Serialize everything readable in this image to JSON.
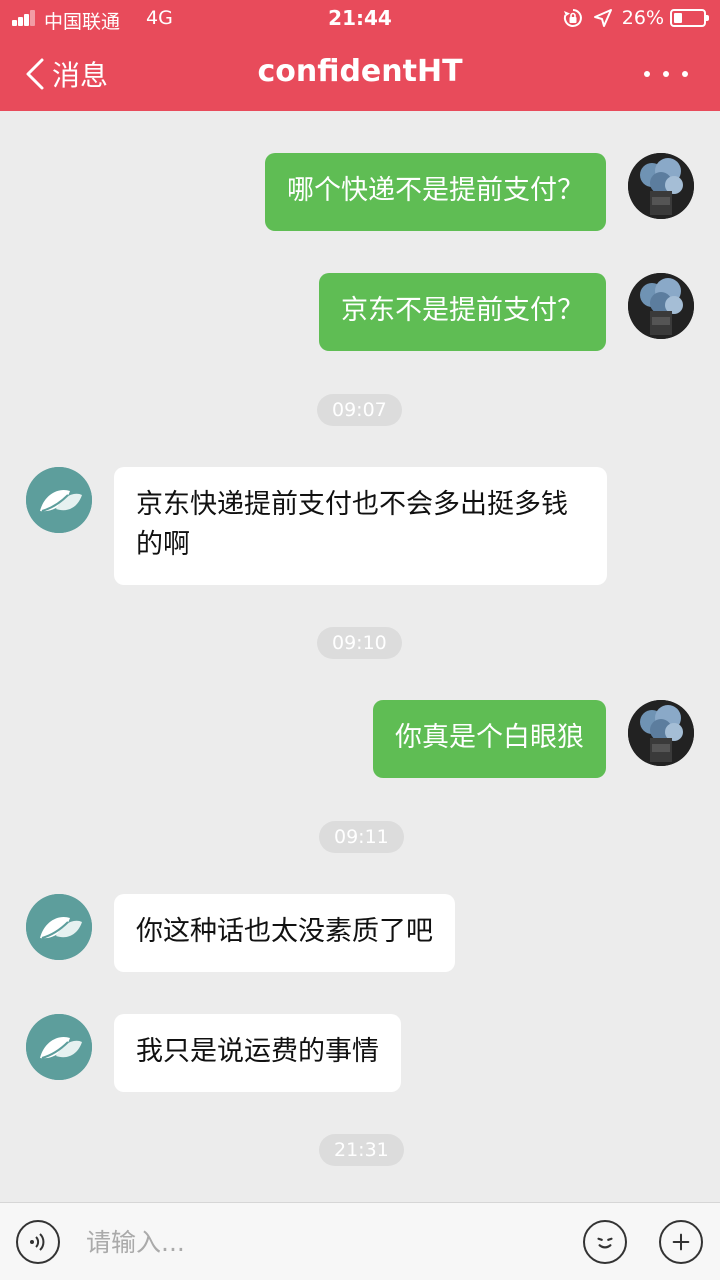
{
  "status_bar": {
    "carrier": "中国联通",
    "network": "4G",
    "time": "21:44",
    "battery": "26%",
    "battery_level": 0.26
  },
  "nav": {
    "back_label": "消息",
    "title": "confidentHT",
    "more_icon": "more-icon"
  },
  "messages": [
    {
      "type": "message",
      "side": "me",
      "text": "哪个快递不是提前支付？"
    },
    {
      "type": "message",
      "side": "me",
      "text": "京东不是提前支付？"
    },
    {
      "type": "timestamp",
      "text": "09:07"
    },
    {
      "type": "message",
      "side": "other",
      "text": "京东快递提前支付也不会多出挺多钱的啊"
    },
    {
      "type": "timestamp",
      "text": "09:10"
    },
    {
      "type": "message",
      "side": "me",
      "text": "你真是个白眼狼"
    },
    {
      "type": "timestamp",
      "text": "09:11"
    },
    {
      "type": "message",
      "side": "other",
      "text": "你这种话也太没素质了吧"
    },
    {
      "type": "message",
      "side": "other",
      "text": "我只是说运费的事情"
    },
    {
      "type": "timestamp",
      "text": "21:31"
    }
  ],
  "input_bar": {
    "placeholder": "请输入...",
    "value": ""
  },
  "colors": {
    "header": "#e84b5b",
    "sent_bubble": "#5fbd54",
    "received_bubble": "#ffffff",
    "background": "#ececec"
  },
  "icons": [
    "signal-icon",
    "lock-rotation-icon",
    "location-arrow-icon",
    "battery-icon",
    "back-chevron-icon",
    "more-icon",
    "voice-icon",
    "emoji-icon",
    "plus-icon",
    "leaf-avatar-icon",
    "flower-avatar-icon"
  ]
}
